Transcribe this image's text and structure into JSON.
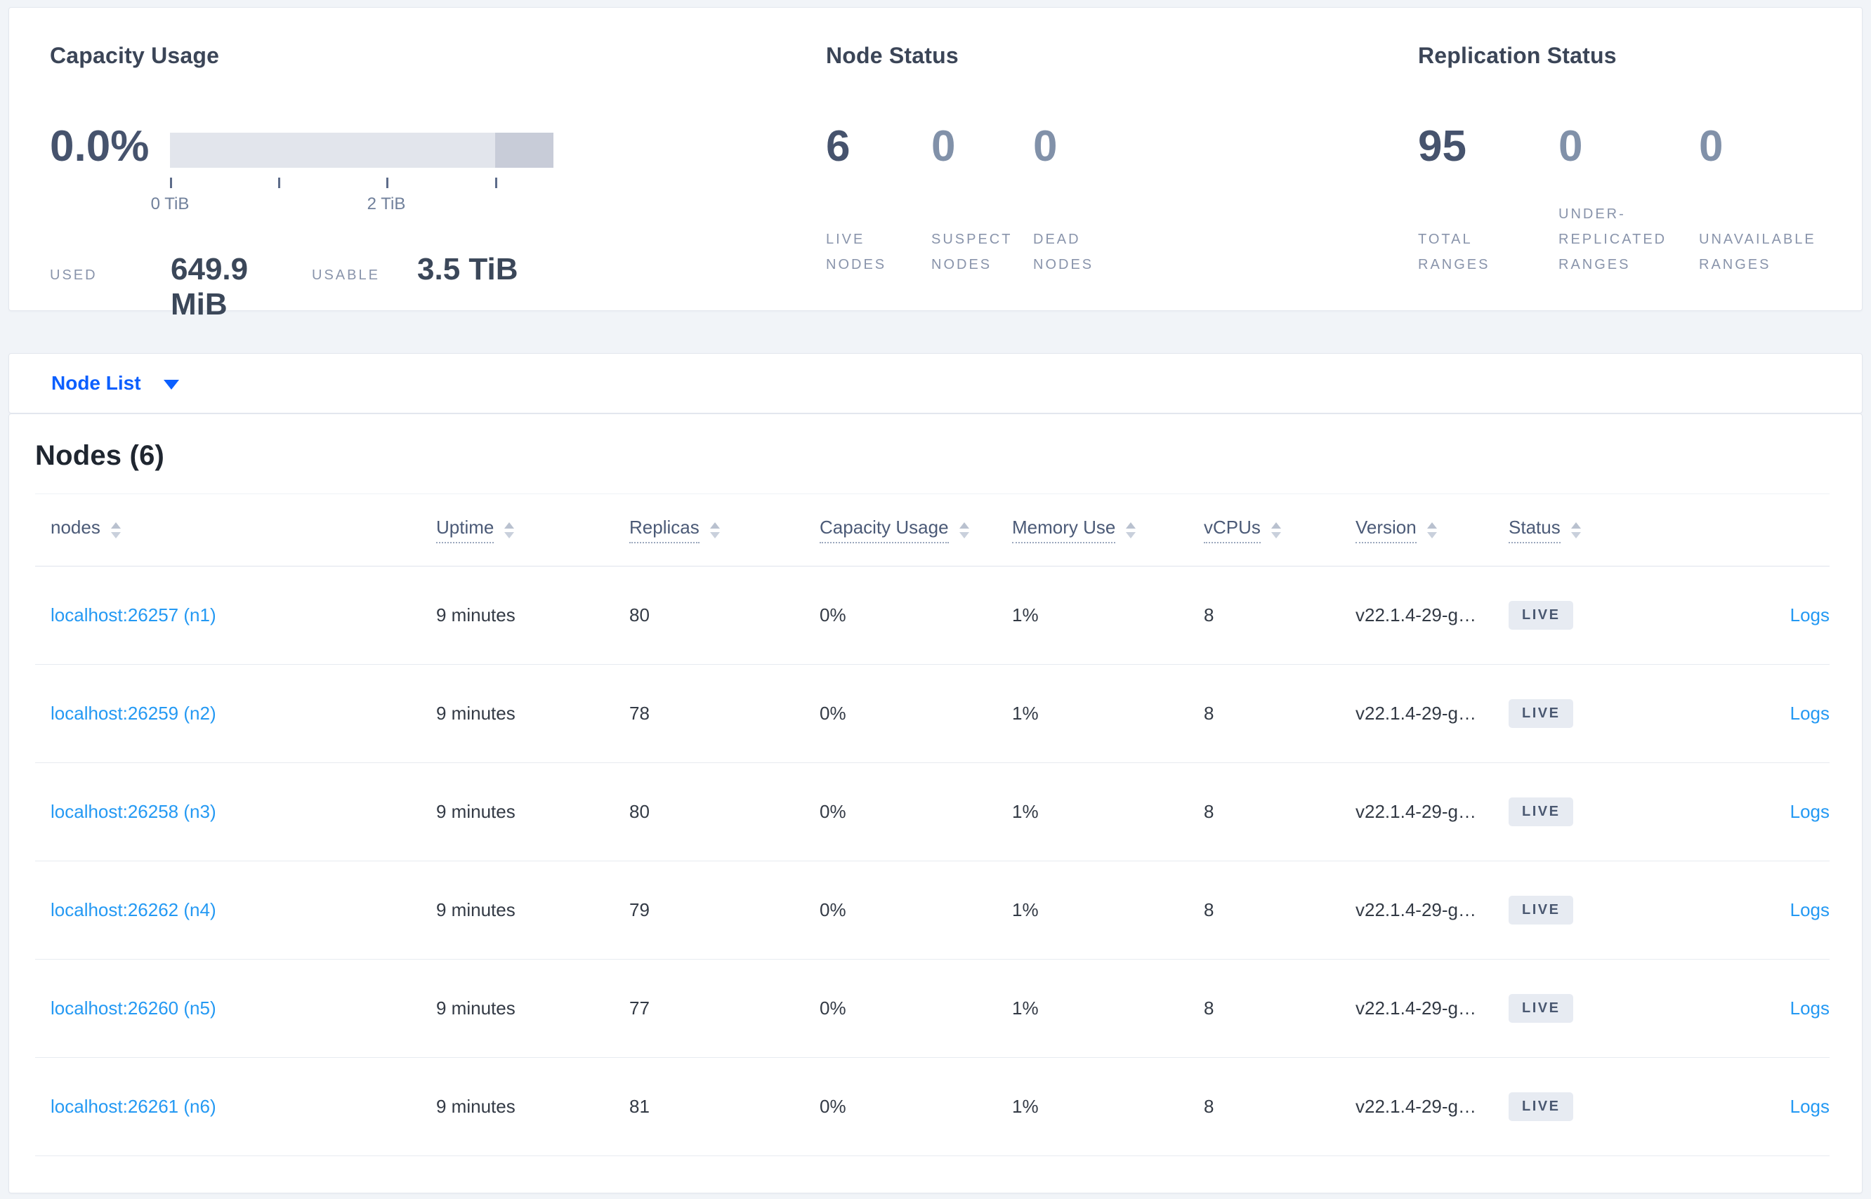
{
  "colors": {
    "accent_blue": "#0b5fff",
    "link_blue": "#2499f3",
    "badge_bg": "#e7ebf2",
    "bar_fill": "#e2e5ec",
    "bar_remainder": "#c8ccd8",
    "page_bg": "#f1f4f8"
  },
  "summary": {
    "capacity": {
      "title": "Capacity Usage",
      "percent": "0.0%",
      "tick0_label": "0 TiB",
      "tick2_label": "2 TiB",
      "used_label": "USED",
      "used_value": "649.9 MiB",
      "usable_label": "USABLE",
      "usable_value": "3.5 TiB"
    },
    "node_status": {
      "title": "Node Status",
      "stats": [
        {
          "value": "6",
          "label": "LIVE NODES"
        },
        {
          "value": "0",
          "label": "SUSPECT NODES"
        },
        {
          "value": "0",
          "label": "DEAD NODES"
        }
      ]
    },
    "replication": {
      "title": "Replication Status",
      "stats": [
        {
          "value": "95",
          "label": "TOTAL RANGES"
        },
        {
          "value": "0",
          "label": "UNDER-REPLICATED RANGES"
        },
        {
          "value": "0",
          "label": "UNAVAILABLE RANGES"
        }
      ]
    }
  },
  "view_selector": {
    "label": "Node List"
  },
  "table": {
    "title": "Nodes (6)",
    "logs_label": "Logs",
    "columns": [
      {
        "label": "nodes"
      },
      {
        "label": "Uptime"
      },
      {
        "label": "Replicas"
      },
      {
        "label": "Capacity Usage"
      },
      {
        "label": "Memory Use"
      },
      {
        "label": "vCPUs"
      },
      {
        "label": "Version"
      },
      {
        "label": "Status"
      }
    ],
    "rows": [
      {
        "address": "localhost:26257 (n1)",
        "uptime": "9 minutes",
        "replicas": "80",
        "capacity": "0%",
        "memory": "1%",
        "vcpus": "8",
        "version": "v22.1.4-29-g…",
        "status": "LIVE"
      },
      {
        "address": "localhost:26259 (n2)",
        "uptime": "9 minutes",
        "replicas": "78",
        "capacity": "0%",
        "memory": "1%",
        "vcpus": "8",
        "version": "v22.1.4-29-g…",
        "status": "LIVE"
      },
      {
        "address": "localhost:26258 (n3)",
        "uptime": "9 minutes",
        "replicas": "80",
        "capacity": "0%",
        "memory": "1%",
        "vcpus": "8",
        "version": "v22.1.4-29-g…",
        "status": "LIVE"
      },
      {
        "address": "localhost:26262 (n4)",
        "uptime": "9 minutes",
        "replicas": "79",
        "capacity": "0%",
        "memory": "1%",
        "vcpus": "8",
        "version": "v22.1.4-29-g…",
        "status": "LIVE"
      },
      {
        "address": "localhost:26260 (n5)",
        "uptime": "9 minutes",
        "replicas": "77",
        "capacity": "0%",
        "memory": "1%",
        "vcpus": "8",
        "version": "v22.1.4-29-g…",
        "status": "LIVE"
      },
      {
        "address": "localhost:26261 (n6)",
        "uptime": "9 minutes",
        "replicas": "81",
        "capacity": "0%",
        "memory": "1%",
        "vcpus": "8",
        "version": "v22.1.4-29-g…",
        "status": "LIVE"
      }
    ]
  }
}
